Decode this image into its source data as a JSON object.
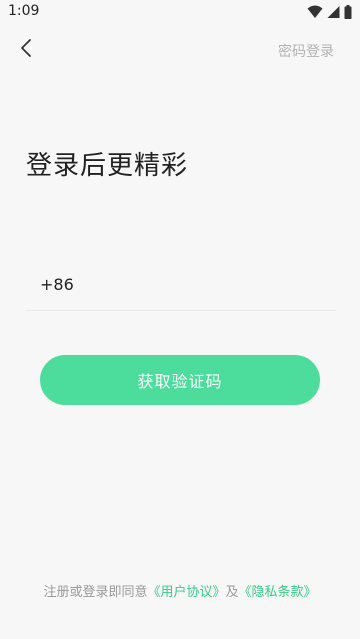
{
  "status_bar": {
    "time": "1:09",
    "icons": [
      "wifi-icon",
      "signal-icon",
      "battery-icon"
    ]
  },
  "header": {
    "back_icon": "chevron-left-icon",
    "password_login_label": "密码登录"
  },
  "main": {
    "title": "登录后更精彩",
    "country_code": "+86",
    "phone_value": "",
    "phone_placeholder": "",
    "get_code_label": "获取验证码"
  },
  "footer": {
    "prefix": "注册或登录即同意",
    "user_agreement": "《用户协议》",
    "conjunction": "及",
    "privacy_policy": "《隐私条款》"
  },
  "colors": {
    "accent": "#4cdd9c",
    "link": "#3ac98a",
    "background": "#f7f7f7",
    "muted_text": "#9a9a9a"
  }
}
